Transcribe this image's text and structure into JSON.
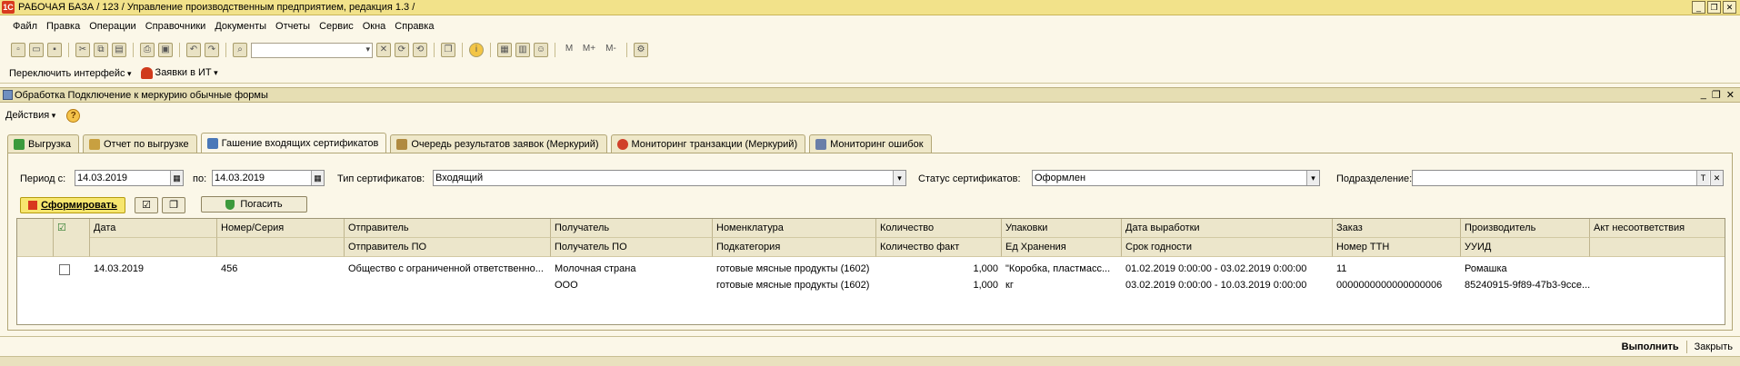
{
  "window": {
    "title": "РАБОЧАЯ БАЗА / 123 / Управление производственным предприятием, редакция 1.3 /"
  },
  "menu": [
    "Файл",
    "Правка",
    "Операции",
    "Справочники",
    "Документы",
    "Отчеты",
    "Сервис",
    "Окна",
    "Справка"
  ],
  "toolbar2": {
    "switch_interface": "Переключить интерфейс",
    "requests": "Заявки в ИТ"
  },
  "form": {
    "title": "Обработка  Подключение к меркурию обычные формы",
    "actions_label": "Действия"
  },
  "tabs": [
    {
      "label": "Выгрузка",
      "color": "#3C9A3C"
    },
    {
      "label": "Отчет по выгрузке",
      "color": "#C8A040"
    },
    {
      "label": "Гашение входящих сертификатов",
      "color": "#4A78B8"
    },
    {
      "label": "Очередь результатов заявок (Меркурий)",
      "color": "#B08A40"
    },
    {
      "label": "Мониторинг транзакции (Меркурий)",
      "color": "#D0402A"
    },
    {
      "label": "Мониторинг ошибок",
      "color": "#6A7EA8"
    }
  ],
  "filters": {
    "period_from_label": "Период с:",
    "period_from": "14.03.2019",
    "period_to_label": "по:",
    "period_to": "14.03.2019",
    "cert_type_label": "Тип сертификатов:",
    "cert_type": "Входящий",
    "cert_status_label": "Статус сертификатов:",
    "cert_status": "Оформлен",
    "division_label": "Подразделение:",
    "division": ""
  },
  "buttons": {
    "generate": "Сформировать",
    "redeem": "Погасить"
  },
  "table": {
    "headers_top": [
      "Дата",
      "Номер/Серия",
      "Отправитель",
      "Получатель",
      "Номенклатура",
      "Количество",
      "Упаковки",
      "Дата выработки",
      "Заказ",
      "Производитель",
      "Акт несоответствия"
    ],
    "headers_bottom": [
      "",
      "",
      "Отправитель ПО",
      "Получатель ПО",
      "Подкатегория",
      "Количество факт",
      "Ед Хранения",
      "Срок годности",
      "Номер ТТН",
      "УУИД",
      ""
    ],
    "rows": [
      {
        "line1": [
          "14.03.2019",
          "456",
          "Общество с ограниченной ответственно...",
          "Молочная страна",
          "готовые мясные продукты (1602)",
          "1,000",
          "\"Коробка, пластмасс...",
          "01.02.2019 0:00:00 - 03.02.2019 0:00:00",
          "11",
          "Ромашка",
          ""
        ],
        "line2": [
          "",
          "",
          "",
          "ООО",
          "готовые мясные продукты (1602)",
          "1,000",
          "кг",
          "03.02.2019 0:00:00 - 10.03.2019 0:00:00",
          "0000000000000000006",
          "85240915-9f89-47b3-9cce...",
          ""
        ]
      }
    ]
  },
  "footer": {
    "execute": "Выполнить",
    "close": "Закрыть"
  }
}
